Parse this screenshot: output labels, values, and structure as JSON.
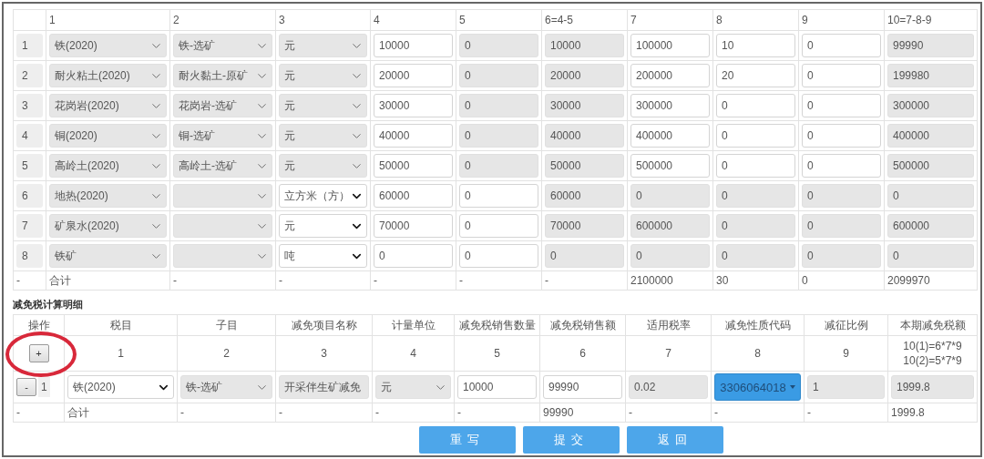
{
  "top_table": {
    "columns": [
      "1",
      "2",
      "3",
      "4",
      "5",
      "6=4-5",
      "7",
      "8",
      "9",
      "10=7-8-9"
    ],
    "rows": [
      {
        "index": "1",
        "cells": [
          {
            "kind": "select",
            "value": "铁(2020)",
            "disabled": true
          },
          {
            "kind": "select",
            "value": "铁-选矿",
            "disabled": true
          },
          {
            "kind": "select",
            "value": "元",
            "disabled": true
          },
          {
            "kind": "input",
            "value": "10000",
            "disabled": false
          },
          {
            "kind": "input",
            "value": "0",
            "disabled": true
          },
          {
            "kind": "input",
            "value": "10000",
            "disabled": true
          },
          {
            "kind": "input",
            "value": "100000",
            "disabled": false
          },
          {
            "kind": "input",
            "value": "10",
            "disabled": false
          },
          {
            "kind": "input",
            "value": "0",
            "disabled": false
          },
          {
            "kind": "input",
            "value": "99990",
            "disabled": true
          }
        ]
      },
      {
        "index": "2",
        "cells": [
          {
            "kind": "select",
            "value": "耐火粘土(2020)",
            "disabled": true
          },
          {
            "kind": "select",
            "value": "耐火黏土-原矿",
            "disabled": true
          },
          {
            "kind": "select",
            "value": "元",
            "disabled": true
          },
          {
            "kind": "input",
            "value": "20000",
            "disabled": false
          },
          {
            "kind": "input",
            "value": "0",
            "disabled": true
          },
          {
            "kind": "input",
            "value": "20000",
            "disabled": true
          },
          {
            "kind": "input",
            "value": "200000",
            "disabled": false
          },
          {
            "kind": "input",
            "value": "20",
            "disabled": false
          },
          {
            "kind": "input",
            "value": "0",
            "disabled": false
          },
          {
            "kind": "input",
            "value": "199980",
            "disabled": true
          }
        ]
      },
      {
        "index": "3",
        "cells": [
          {
            "kind": "select",
            "value": "花岗岩(2020)",
            "disabled": true
          },
          {
            "kind": "select",
            "value": "花岗岩-选矿",
            "disabled": true
          },
          {
            "kind": "select",
            "value": "元",
            "disabled": true
          },
          {
            "kind": "input",
            "value": "30000",
            "disabled": false
          },
          {
            "kind": "input",
            "value": "0",
            "disabled": true
          },
          {
            "kind": "input",
            "value": "30000",
            "disabled": true
          },
          {
            "kind": "input",
            "value": "300000",
            "disabled": false
          },
          {
            "kind": "input",
            "value": "0",
            "disabled": false
          },
          {
            "kind": "input",
            "value": "0",
            "disabled": false
          },
          {
            "kind": "input",
            "value": "300000",
            "disabled": true
          }
        ]
      },
      {
        "index": "4",
        "cells": [
          {
            "kind": "select",
            "value": "铜(2020)",
            "disabled": true
          },
          {
            "kind": "select",
            "value": "铜-选矿",
            "disabled": true
          },
          {
            "kind": "select",
            "value": "元",
            "disabled": true
          },
          {
            "kind": "input",
            "value": "40000",
            "disabled": false
          },
          {
            "kind": "input",
            "value": "0",
            "disabled": true
          },
          {
            "kind": "input",
            "value": "40000",
            "disabled": true
          },
          {
            "kind": "input",
            "value": "400000",
            "disabled": false
          },
          {
            "kind": "input",
            "value": "0",
            "disabled": false
          },
          {
            "kind": "input",
            "value": "0",
            "disabled": false
          },
          {
            "kind": "input",
            "value": "400000",
            "disabled": true
          }
        ]
      },
      {
        "index": "5",
        "cells": [
          {
            "kind": "select",
            "value": "高岭土(2020)",
            "disabled": true
          },
          {
            "kind": "select",
            "value": "高岭土-选矿",
            "disabled": true
          },
          {
            "kind": "select",
            "value": "元",
            "disabled": true
          },
          {
            "kind": "input",
            "value": "50000",
            "disabled": false
          },
          {
            "kind": "input",
            "value": "0",
            "disabled": true
          },
          {
            "kind": "input",
            "value": "50000",
            "disabled": true
          },
          {
            "kind": "input",
            "value": "500000",
            "disabled": false
          },
          {
            "kind": "input",
            "value": "0",
            "disabled": false
          },
          {
            "kind": "input",
            "value": "0",
            "disabled": false
          },
          {
            "kind": "input",
            "value": "500000",
            "disabled": true
          }
        ]
      },
      {
        "index": "6",
        "cells": [
          {
            "kind": "select",
            "value": "地热(2020)",
            "disabled": true
          },
          {
            "kind": "select",
            "disabled": true
          },
          {
            "kind": "select",
            "value": "立方米（方）",
            "disabled": false
          },
          {
            "kind": "input",
            "value": "60000",
            "disabled": false
          },
          {
            "kind": "input",
            "value": "0",
            "disabled": false
          },
          {
            "kind": "input",
            "value": "60000",
            "disabled": true
          },
          {
            "kind": "input",
            "value": "0",
            "disabled": true
          },
          {
            "kind": "input",
            "value": "0",
            "disabled": true
          },
          {
            "kind": "input",
            "value": "0",
            "disabled": true
          },
          {
            "kind": "input",
            "value": "0",
            "disabled": true
          }
        ]
      },
      {
        "index": "7",
        "cells": [
          {
            "kind": "select",
            "value": "矿泉水(2020)",
            "disabled": true
          },
          {
            "kind": "select",
            "disabled": true
          },
          {
            "kind": "select",
            "value": "元",
            "disabled": false
          },
          {
            "kind": "input",
            "value": "70000",
            "disabled": false
          },
          {
            "kind": "input",
            "value": "0",
            "disabled": false
          },
          {
            "kind": "input",
            "value": "70000",
            "disabled": true
          },
          {
            "kind": "input",
            "value": "600000",
            "disabled": true
          },
          {
            "kind": "input",
            "value": "0",
            "disabled": true
          },
          {
            "kind": "input",
            "value": "0",
            "disabled": true
          },
          {
            "kind": "input",
            "value": "600000",
            "disabled": true
          }
        ]
      },
      {
        "index": "8",
        "cells": [
          {
            "kind": "select",
            "value": "铁矿",
            "disabled": true
          },
          {
            "kind": "select",
            "disabled": true
          },
          {
            "kind": "select",
            "value": "吨",
            "disabled": false
          },
          {
            "kind": "input",
            "value": "0",
            "disabled": false
          },
          {
            "kind": "input",
            "value": "0",
            "disabled": false
          },
          {
            "kind": "input",
            "value": "0",
            "disabled": true
          },
          {
            "kind": "input",
            "value": "0",
            "disabled": true
          },
          {
            "kind": "input",
            "value": "0",
            "disabled": true
          },
          {
            "kind": "input",
            "value": "0",
            "disabled": true
          },
          {
            "kind": "input",
            "value": "0",
            "disabled": true
          }
        ]
      }
    ],
    "total": [
      "-",
      "合计",
      "-",
      "-",
      "-",
      "-",
      "-",
      "2100000",
      "30",
      "0",
      "2099970"
    ]
  },
  "section_title": "减免税计算明细",
  "detail_table": {
    "columns": [
      "操作",
      "税目",
      "子目",
      "减免项目名称",
      "计量单位",
      "减免税销售数量",
      "减免税销售额",
      "适用税率",
      "减免性质代码",
      "减征比例",
      "本期减免税额"
    ],
    "add_button": "+",
    "numbers": [
      "1",
      "2",
      "3",
      "4",
      "5",
      "6",
      "7",
      "8",
      "9"
    ],
    "formulas": [
      "10(1)=6*7*9",
      "10(2)=5*7*9"
    ],
    "rows": [
      {
        "cells": [
          {
            "kind": "action",
            "button": "-",
            "index": "1"
          },
          {
            "kind": "select",
            "value": "铁(2020)",
            "disabled": false
          },
          {
            "kind": "select",
            "value": "铁-选矿",
            "disabled": true
          },
          {
            "kind": "input",
            "value": "开采伴生矿减免",
            "disabled": true
          },
          {
            "kind": "select",
            "value": "元",
            "disabled": true
          },
          {
            "kind": "input",
            "value": "10000",
            "disabled": false
          },
          {
            "kind": "input",
            "value": "99990",
            "disabled": false
          },
          {
            "kind": "input",
            "value": "0.02",
            "disabled": true
          },
          {
            "kind": "dropdown",
            "value": "3306064018"
          },
          {
            "kind": "input",
            "value": "1",
            "disabled": true
          },
          {
            "kind": "input",
            "value": "1999.8",
            "disabled": true
          }
        ]
      }
    ],
    "total": [
      "-",
      "合计",
      "-",
      "-",
      "-",
      "-",
      "99990",
      "-",
      "-",
      "-",
      "1999.8"
    ]
  },
  "buttons": [
    "重写",
    "提交",
    "返回"
  ]
}
